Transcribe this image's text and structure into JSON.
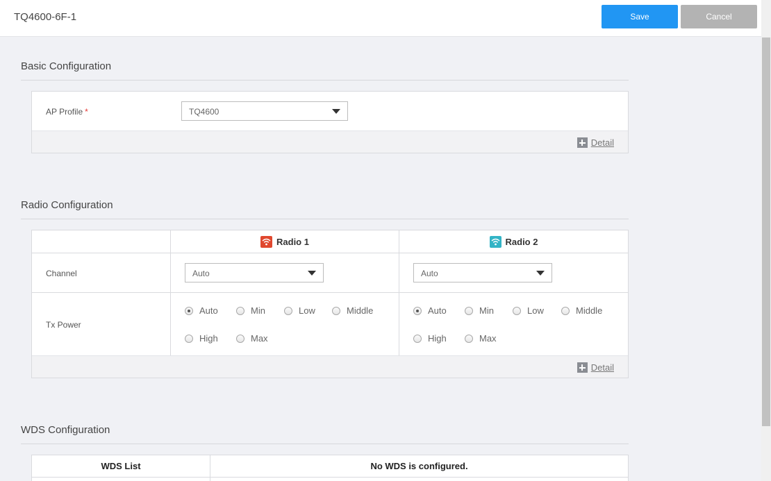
{
  "header": {
    "title": "TQ4600-6F-1",
    "save_label": "Save",
    "cancel_label": "Cancel"
  },
  "basic": {
    "title": "Basic Configuration",
    "ap_profile_label": "AP Profile",
    "required_mark": "*",
    "ap_profile_value": "TQ4600",
    "detail_label": "Detail"
  },
  "radio": {
    "title": "Radio Configuration",
    "radio1_label": "Radio 1",
    "radio2_label": "Radio 2",
    "channel_label": "Channel",
    "txpower_label": "Tx Power",
    "radio1_channel": "Auto",
    "radio2_channel": "Auto",
    "txpower_options": [
      "Auto",
      "Min",
      "Low",
      "Middle",
      "High",
      "Max"
    ],
    "radio1_txpower_selected": "Auto",
    "radio2_txpower_selected": "Auto",
    "detail_label": "Detail"
  },
  "wds": {
    "title": "WDS Configuration",
    "list_header": "WDS List",
    "empty_message": "No WDS is configured."
  },
  "colors": {
    "primary": "#2196f3",
    "cancel": "#b3b3b3",
    "radio1_icon": "#e0482f",
    "radio2_icon": "#33b4c6",
    "required": "#e53935"
  }
}
